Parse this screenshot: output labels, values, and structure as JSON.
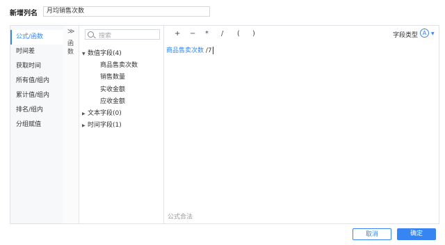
{
  "dialog": {
    "title_label": "新增列名",
    "column_name_value": "月均销售次数"
  },
  "left_nav": {
    "items": [
      "公式/函数",
      "时间差",
      "获取时间",
      "所有值/组内",
      "累计值/组内",
      "排名/组内",
      "分组赋值"
    ],
    "active_index": 0
  },
  "collapse": {
    "toggle": "≫",
    "label": "函数"
  },
  "tree": {
    "search_placeholder": "搜索",
    "numeric_group": "数值字段(4)",
    "numeric_fields": [
      "商品售卖次数",
      "销售数量",
      "实收金额",
      "应收金额"
    ],
    "text_group": "文本字段(0)",
    "time_group": "时间字段(1)"
  },
  "editor": {
    "operators": [
      "+",
      "−",
      "*",
      "/",
      "(",
      ")"
    ],
    "field_type_label": "字段类型",
    "field_type_icon": "A",
    "formula_field": "商品售卖次数",
    "formula_rest": "/7",
    "status_hint": "公式合法"
  },
  "buttons": {
    "cancel": "取消",
    "ok": "确定"
  },
  "colors": {
    "accent": "#3685f2"
  }
}
